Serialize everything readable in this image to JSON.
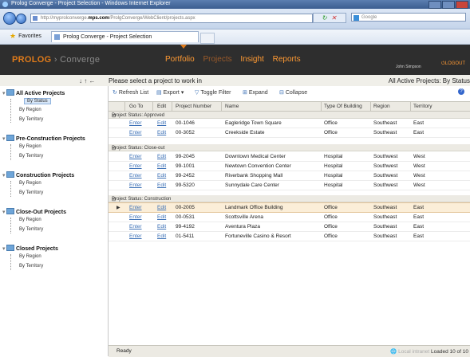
{
  "window": {
    "title": "Prolog Converge - Project Selection - Windows Internet Explorer"
  },
  "browser": {
    "address_prefix": "http://",
    "address_host": "mps.com",
    "address_url_rest": "/ProlgConverge/WebClient/projects.aspx",
    "address_host_prefix": "myprolconverge.",
    "search_placeholder": "Google",
    "favorites_label": "Favorites",
    "tab_title": "Prolog Converge - Project Selection"
  },
  "app": {
    "logo_main": "PROLOG",
    "logo_sep": " › ",
    "logo_sub": "Converge",
    "nav": {
      "portfolio": "Portfolio",
      "projects": "Projects",
      "insight": "Insight",
      "reports": "Reports"
    },
    "user": "John Simpson",
    "logout": "LOGOUT",
    "prompt": "Please select a project to work in",
    "breadcrumb": "All Active Projects: By Status"
  },
  "sidebar": {
    "groups": [
      {
        "label": "All Active Projects",
        "subs": [
          "By Status",
          "By Region",
          "By Territory"
        ]
      },
      {
        "label": "Pre-Construction Projects",
        "subs": [
          "By Region",
          "By Territory"
        ]
      },
      {
        "label": "Construction Projects",
        "subs": [
          "By Region",
          "By Territory"
        ]
      },
      {
        "label": "Close-Out Projects",
        "subs": [
          "By Region",
          "By Territory"
        ]
      },
      {
        "label": "Closed Projects",
        "subs": [
          "By Region",
          "By Territory"
        ]
      }
    ]
  },
  "toolbar": {
    "refresh": "Refresh List",
    "export": "Export",
    "toggle_filter": "Toggle Filter",
    "expand": "Expand",
    "collapse": "Collapse"
  },
  "grid": {
    "columns": [
      "Go To",
      "Edit",
      "Project Number",
      "Name",
      "Type Of Building",
      "Region",
      "Territory"
    ],
    "groups": [
      {
        "status": "Project Status: Approved",
        "rows": [
          [
            "Enter",
            "Edit",
            "00-1046",
            "Eagleridge Town Square",
            "Office",
            "Southeast",
            "East"
          ],
          [
            "Enter",
            "Edit",
            "00-3052",
            "Creekside Estate",
            "Office",
            "Southeast",
            "East"
          ]
        ]
      },
      {
        "status": "Project Status: Close-out",
        "rows": [
          [
            "Enter",
            "Edit",
            "99-2045",
            "Downtown Medical Center",
            "Hospital",
            "Southwest",
            "West"
          ],
          [
            "Enter",
            "Edit",
            "99-1001",
            "Newtown Convention Center",
            "Hospital",
            "Southwest",
            "West"
          ],
          [
            "Enter",
            "Edit",
            "99-2452",
            "Riverbank Shopping Mall",
            "Hospital",
            "Southwest",
            "West"
          ],
          [
            "Enter",
            "Edit",
            "99-5320",
            "Sunnydale Care Center",
            "Hospital",
            "Southwest",
            "West"
          ]
        ]
      },
      {
        "status": "Project Status: Construction",
        "rows": [
          [
            "Enter",
            "Edit",
            "00-2005",
            "Landmark Office Building",
            "Office",
            "Southeast",
            "East"
          ],
          [
            "Enter",
            "Edit",
            "00-0531",
            "Scottsville Arena",
            "Office",
            "Southeast",
            "East"
          ],
          [
            "Enter",
            "Edit",
            "99-4192",
            "Aventura Plaza",
            "Office",
            "Southeast",
            "East"
          ],
          [
            "Enter",
            "Edit",
            "01-5411",
            "Fortuneville Casino & Resort",
            "Office",
            "Southeast",
            "East"
          ]
        ]
      }
    ]
  },
  "status": {
    "left": "Ready",
    "zone": "Local intranet",
    "right": "Loaded 10 of 10"
  },
  "colors": {
    "header_bg": "#2e2e2e",
    "brand_orange": "#e07b1a",
    "nav_orange": "#ff9a33"
  }
}
